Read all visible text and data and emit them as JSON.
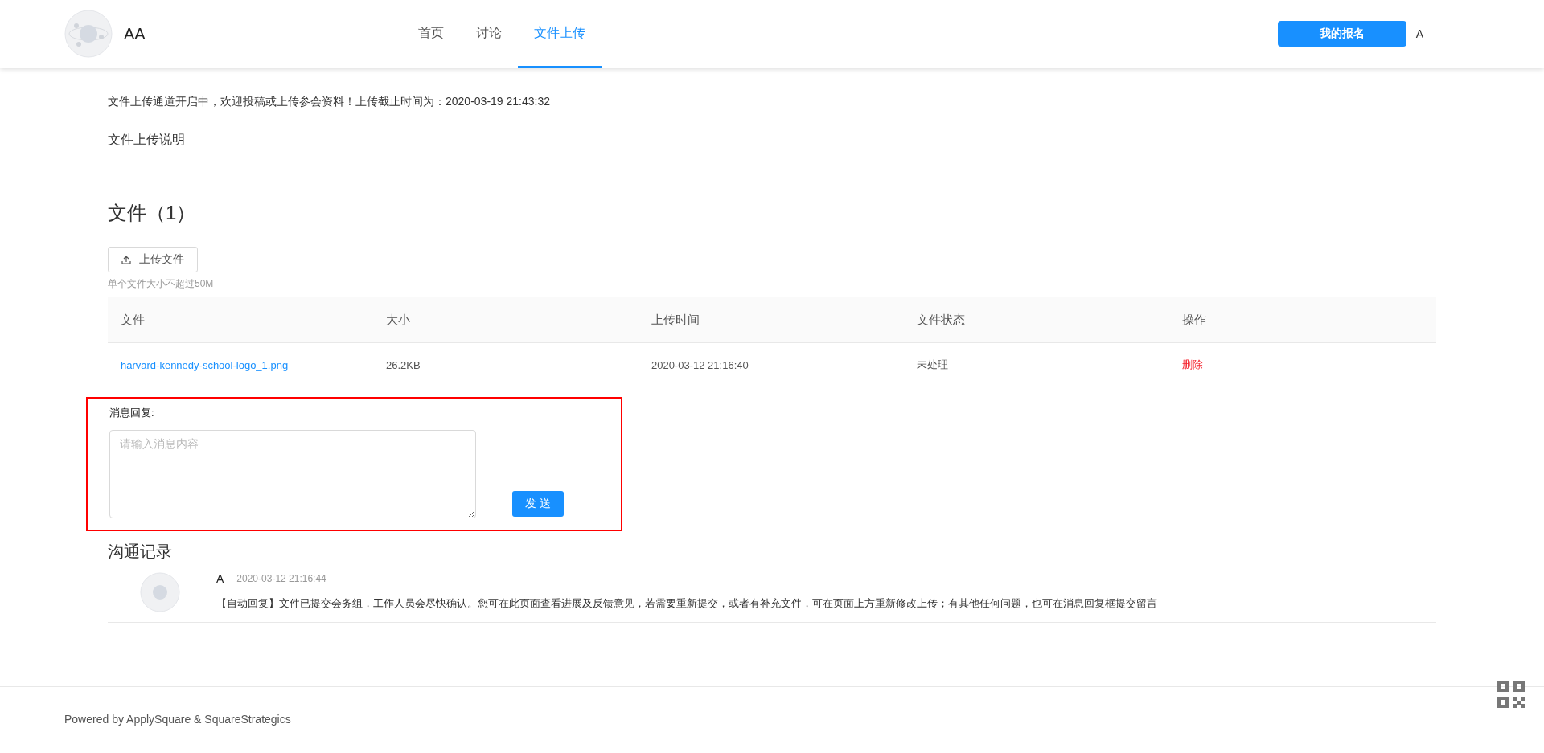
{
  "header": {
    "site_name": "AA",
    "nav": [
      {
        "label": "首页",
        "selected": false
      },
      {
        "label": "讨论",
        "selected": false
      },
      {
        "label": "文件上传",
        "selected": true
      }
    ],
    "signup_button": "我的报名",
    "user": "A"
  },
  "notice": "文件上传通道开启中，欢迎投稿或上传参会资料！上传截止时间为：2020-03-19 21:43:32",
  "instructions_title": "文件上传说明",
  "files_title": "文件（1）",
  "upload_button": "上传文件",
  "upload_hint": "单个文件大小不超过50M",
  "table": {
    "columns": [
      "文件",
      "大小",
      "上传时间",
      "文件状态",
      "操作"
    ],
    "rows": [
      {
        "file": "harvard-kennedy-school-logo_1.png",
        "size": "26.2KB",
        "time": "2020-03-12 21:16:40",
        "status": "未处理",
        "action": "删除"
      }
    ]
  },
  "reply": {
    "label": "消息回复:",
    "placeholder": "请输入消息内容",
    "send_button": "发 送"
  },
  "history": {
    "title": "沟通记录",
    "messages": [
      {
        "author": "A",
        "time": "2020-03-12 21:16:44",
        "text": "【自动回复】文件已提交会务组，工作人员会尽快确认。您可在此页面查看进展及反馈意见，若需要重新提交，或者有补充文件，可在页面上方重新修改上传；有其他任何问题，也可在消息回复框提交留言"
      }
    ]
  },
  "footer": "Powered by ApplySquare & SquareStrategics"
}
